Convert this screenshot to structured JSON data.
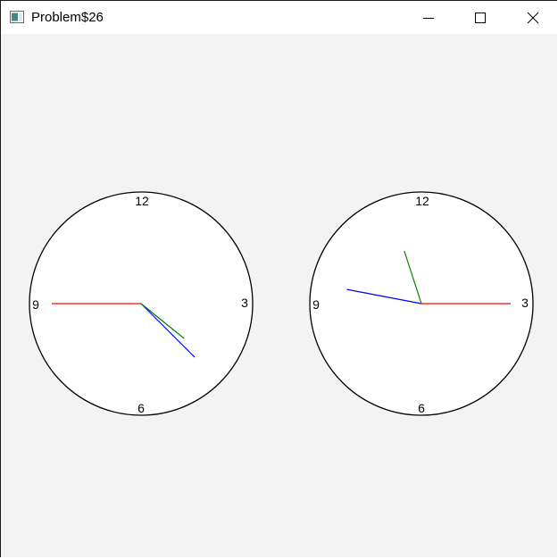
{
  "window": {
    "title": "Problem$26",
    "icon": "app-window-icon",
    "controls": [
      "minimize-icon",
      "maximize-icon",
      "close-icon"
    ]
  },
  "clocks": [
    {
      "labels": {
        "twelve": "12",
        "three": "3",
        "six": "6",
        "nine": "9"
      },
      "time": {
        "hour": 4.3,
        "minute": 22.5,
        "second": 45
      }
    },
    {
      "labels": {
        "twelve": "12",
        "three": "3",
        "six": "6",
        "nine": "9"
      },
      "time": {
        "hour": 11.4,
        "minute": 46.8,
        "second": 15
      }
    }
  ],
  "colors": {
    "hour_hand": "#008000",
    "minute_hand": "#0000ff",
    "second_hand": "#ff0000",
    "face": "#ffffff",
    "rim": "#000000",
    "client_bg": "#f3f3f3"
  }
}
